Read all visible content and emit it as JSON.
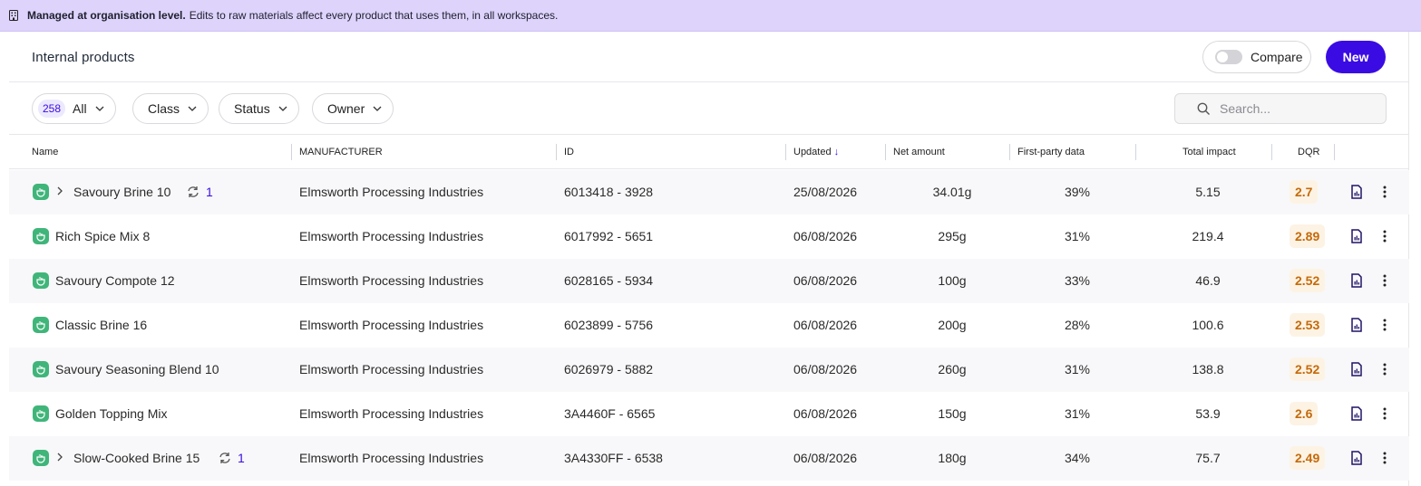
{
  "banner": {
    "icon": "building-icon",
    "bold": "Managed at organisation level.",
    "text": "Edits to raw materials affect every product that uses them, in all workspaces."
  },
  "header": {
    "title": "Internal products",
    "compare_label": "Compare",
    "compare_on": false,
    "new_label": "New"
  },
  "filters": {
    "all_count": "258",
    "all_label": "All",
    "class_label": "Class",
    "status_label": "Status",
    "owner_label": "Owner",
    "search_placeholder": "Search..."
  },
  "columns": {
    "name": "Name",
    "manufacturer": "MANUFACTURER",
    "id": "ID",
    "updated": "Updated",
    "updated_sort": "↓",
    "net_amount": "Net amount",
    "first_party": "First-party data",
    "total_impact": "Total impact",
    "dqr": "DQR"
  },
  "colors": {
    "accent": "#3a0ce3",
    "banner_bg": "#ddd3fb",
    "product_icon": "#40b57a",
    "dqr_text": "#c46a0b",
    "dqr_bg": "#fdf3e4"
  },
  "rows": [
    {
      "name": "Savoury Brine 10",
      "expandable": true,
      "sync_count": "1",
      "manufacturer": "Elmsworth Processing Industries",
      "id": "6013418 - 3928",
      "updated": "25/08/2026",
      "net": "34.01g",
      "first_party": "39%",
      "impact": "5.15",
      "dqr": "2.7"
    },
    {
      "name": "Rich Spice Mix 8",
      "expandable": false,
      "sync_count": "",
      "manufacturer": "Elmsworth Processing Industries",
      "id": "6017992 - 5651",
      "updated": "06/08/2026",
      "net": "295g",
      "first_party": "31%",
      "impact": "219.4",
      "dqr": "2.89"
    },
    {
      "name": "Savoury Compote 12",
      "expandable": false,
      "sync_count": "",
      "manufacturer": "Elmsworth Processing Industries",
      "id": "6028165 - 5934",
      "updated": "06/08/2026",
      "net": "100g",
      "first_party": "33%",
      "impact": "46.9",
      "dqr": "2.52"
    },
    {
      "name": "Classic Brine 16",
      "expandable": false,
      "sync_count": "",
      "manufacturer": "Elmsworth Processing Industries",
      "id": "6023899 - 5756",
      "updated": "06/08/2026",
      "net": "200g",
      "first_party": "28%",
      "impact": "100.6",
      "dqr": "2.53"
    },
    {
      "name": "Savoury Seasoning Blend 10",
      "expandable": false,
      "sync_count": "",
      "manufacturer": "Elmsworth Processing Industries",
      "id": "6026979 - 5882",
      "updated": "06/08/2026",
      "net": "260g",
      "first_party": "31%",
      "impact": "138.8",
      "dqr": "2.52"
    },
    {
      "name": "Golden Topping Mix",
      "expandable": false,
      "sync_count": "",
      "manufacturer": "Elmsworth Processing Industries",
      "id": "3A4460F - 6565",
      "updated": "06/08/2026",
      "net": "150g",
      "first_party": "31%",
      "impact": "53.9",
      "dqr": "2.6"
    },
    {
      "name": "Slow-Cooked Brine 15",
      "expandable": true,
      "sync_count": "1",
      "manufacturer": "Elmsworth Processing Industries",
      "id": "3A4330FF - 6538",
      "updated": "06/08/2026",
      "net": "180g",
      "first_party": "34%",
      "impact": "75.7",
      "dqr": "2.49"
    }
  ]
}
